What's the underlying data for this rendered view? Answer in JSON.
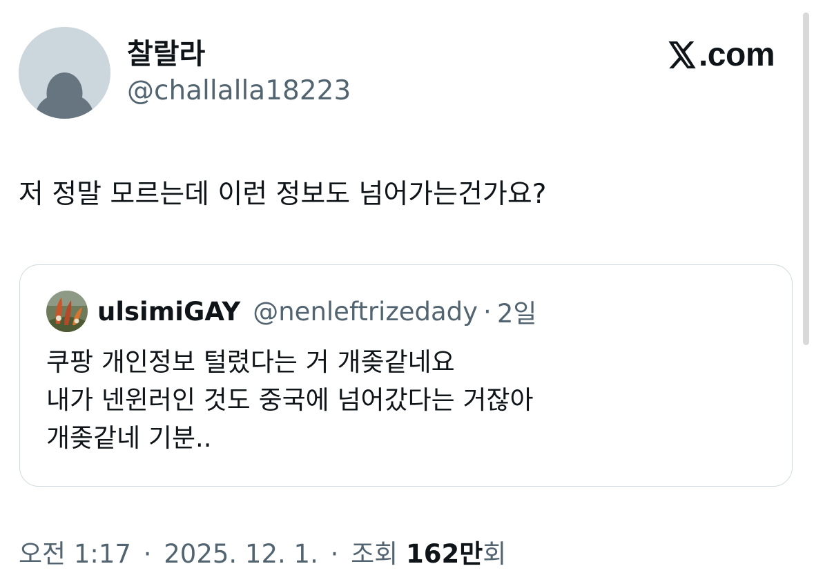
{
  "author": {
    "display_name": "찰랄라",
    "handle": "@challalla18223"
  },
  "brand": {
    "text": ".com",
    "icon": "x-logo-icon"
  },
  "tweet": {
    "text": "저 정말 모르는데 이런 정보도 넘어가는건가요?"
  },
  "quoted_tweet": {
    "display_name": "ulsimiGAY",
    "handle": "@nenleftrizedady",
    "separator": "·",
    "time": "2일",
    "lines": [
      "쿠팡 개인정보 털렸다는 거 개좆같네요",
      "내가 넨윈러인 것도 중국에 넘어갔다는 거잖아",
      "개좆같네 기분.."
    ]
  },
  "meta": {
    "time": "오전 1:17",
    "separator": "·",
    "date": "2025. 12. 1.",
    "views_label": "조회",
    "views_count": "162만",
    "views_suffix": "회"
  },
  "colors": {
    "text_primary": "#0f1419",
    "text_secondary": "#536471",
    "border": "#cfd9de",
    "avatar_bg": "#ccd6dd"
  }
}
